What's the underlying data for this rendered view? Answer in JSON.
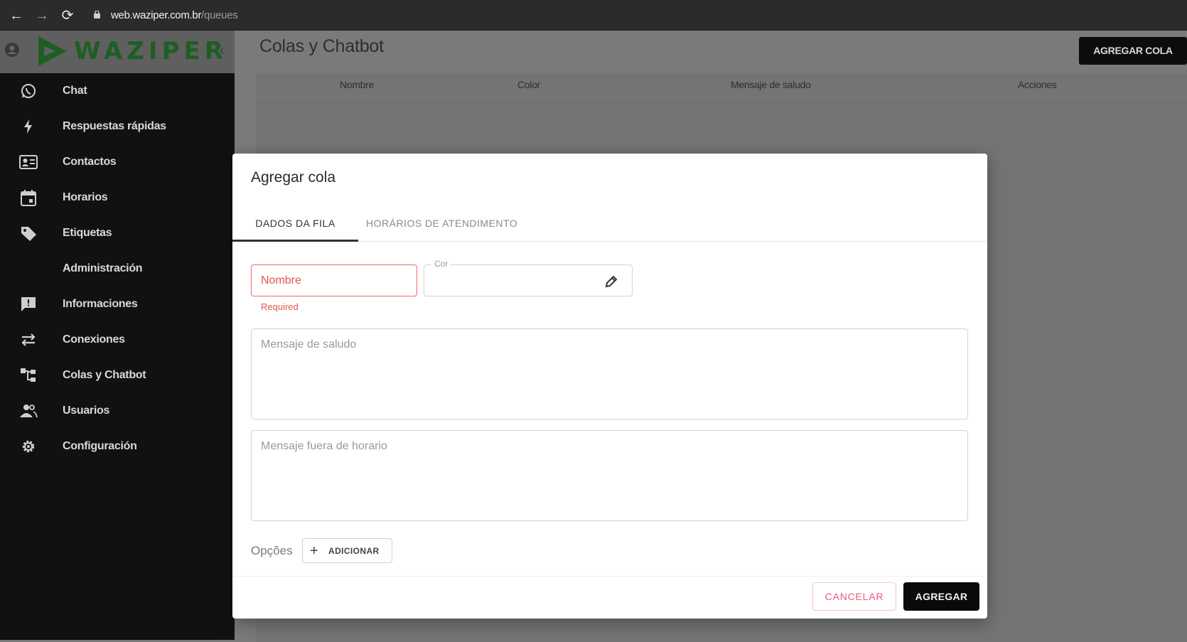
{
  "browser": {
    "url_host": "web.waziper.com.br",
    "url_path": "/queues",
    "icons": [
      "back-arrow-icon",
      "forward-arrow-icon",
      "reload-icon",
      "lock-icon"
    ]
  },
  "sidebar": {
    "logo_text": "WAZIPER",
    "items": [
      {
        "label": "Chat",
        "icon": "whatsapp-icon"
      },
      {
        "label": "Respuestas rápidas",
        "icon": "lightning-icon"
      },
      {
        "label": "Contactos",
        "icon": "contact-card-icon"
      },
      {
        "label": "Horarios",
        "icon": "calendar-icon"
      },
      {
        "label": "Etiquetas",
        "icon": "tag-icon"
      },
      {
        "label": "Administración",
        "icon": ""
      },
      {
        "label": "Informaciones",
        "icon": "announcement-icon"
      },
      {
        "label": "Conexiones",
        "icon": "swap-arrows-icon"
      },
      {
        "label": "Colas y Chatbot",
        "icon": "tree-icon"
      },
      {
        "label": "Usuarios",
        "icon": "people-icon"
      },
      {
        "label": "Configuración",
        "icon": "gear-icon"
      }
    ]
  },
  "main": {
    "title": "Colas y Chatbot",
    "add_button": "AGREGAR COLA",
    "table_headers": [
      "Nombre",
      "Color",
      "Mensaje de saludo",
      "Acciones"
    ]
  },
  "modal": {
    "title": "Agregar cola",
    "tabs": [
      "DADOS DA FILA",
      "HORÁRIOS DE ATENDIMENTO"
    ],
    "name_placeholder": "Nombre",
    "name_helper": "Required",
    "color_label": "Cor",
    "greeting_placeholder": "Mensaje de saludo",
    "out_of_hours_placeholder": "Mensaje fuera de horario",
    "options_label": "Opções",
    "add_option_button": "ADICIONAR",
    "cancel_button": "CANCELAR",
    "submit_button": "AGREGAR"
  },
  "colors": {
    "sidebar_bg": "#111111",
    "overlay_bg": "#7a7a7a",
    "logo_green": "#1e5e25",
    "error_red": "#e2554f",
    "cancel_pink": "#e95a7a",
    "primary_black": "#0a0a0a"
  }
}
